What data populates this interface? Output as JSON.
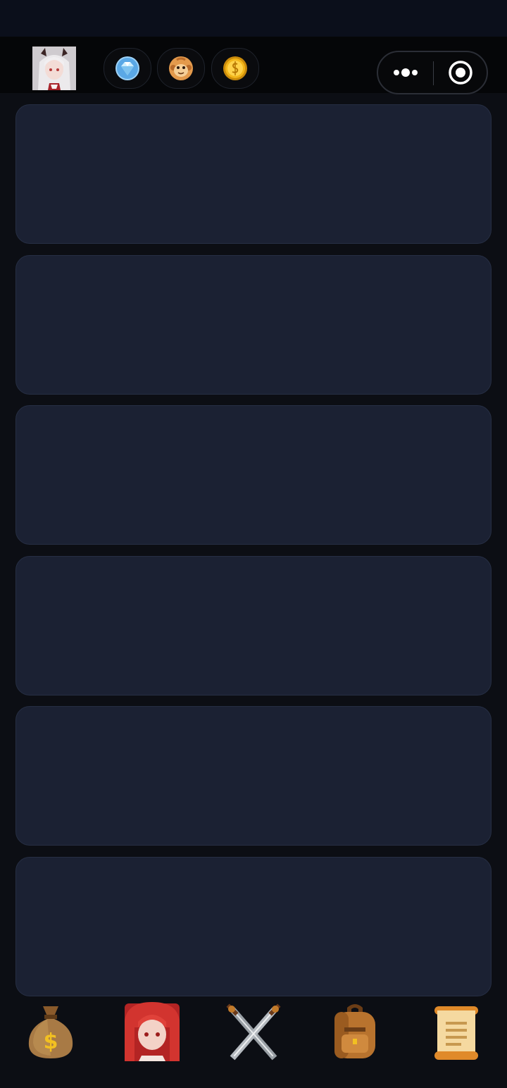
{
  "status_bar": {},
  "header": {
    "avatar": {
      "icon": "anime-girl-avatar-icon"
    },
    "currencies": [
      {
        "icon": "diamond-icon",
        "color": "#5aa8e6"
      },
      {
        "icon": "monkey-icon",
        "color": "#e39a4c"
      },
      {
        "icon": "gold-coin-icon",
        "color": "#f2b519"
      }
    ],
    "capsule": {
      "more_icon": "more-dots-icon",
      "close_icon": "target-close-icon"
    }
  },
  "content": {
    "cards_count": 6,
    "card_color": "#1b2133"
  },
  "tab_bar": {
    "tabs": [
      {
        "icon": "money-bag-icon"
      },
      {
        "icon": "red-hair-girl-icon"
      },
      {
        "icon": "crossed-swords-icon"
      },
      {
        "icon": "backpack-icon"
      },
      {
        "icon": "scroll-icon"
      }
    ]
  }
}
